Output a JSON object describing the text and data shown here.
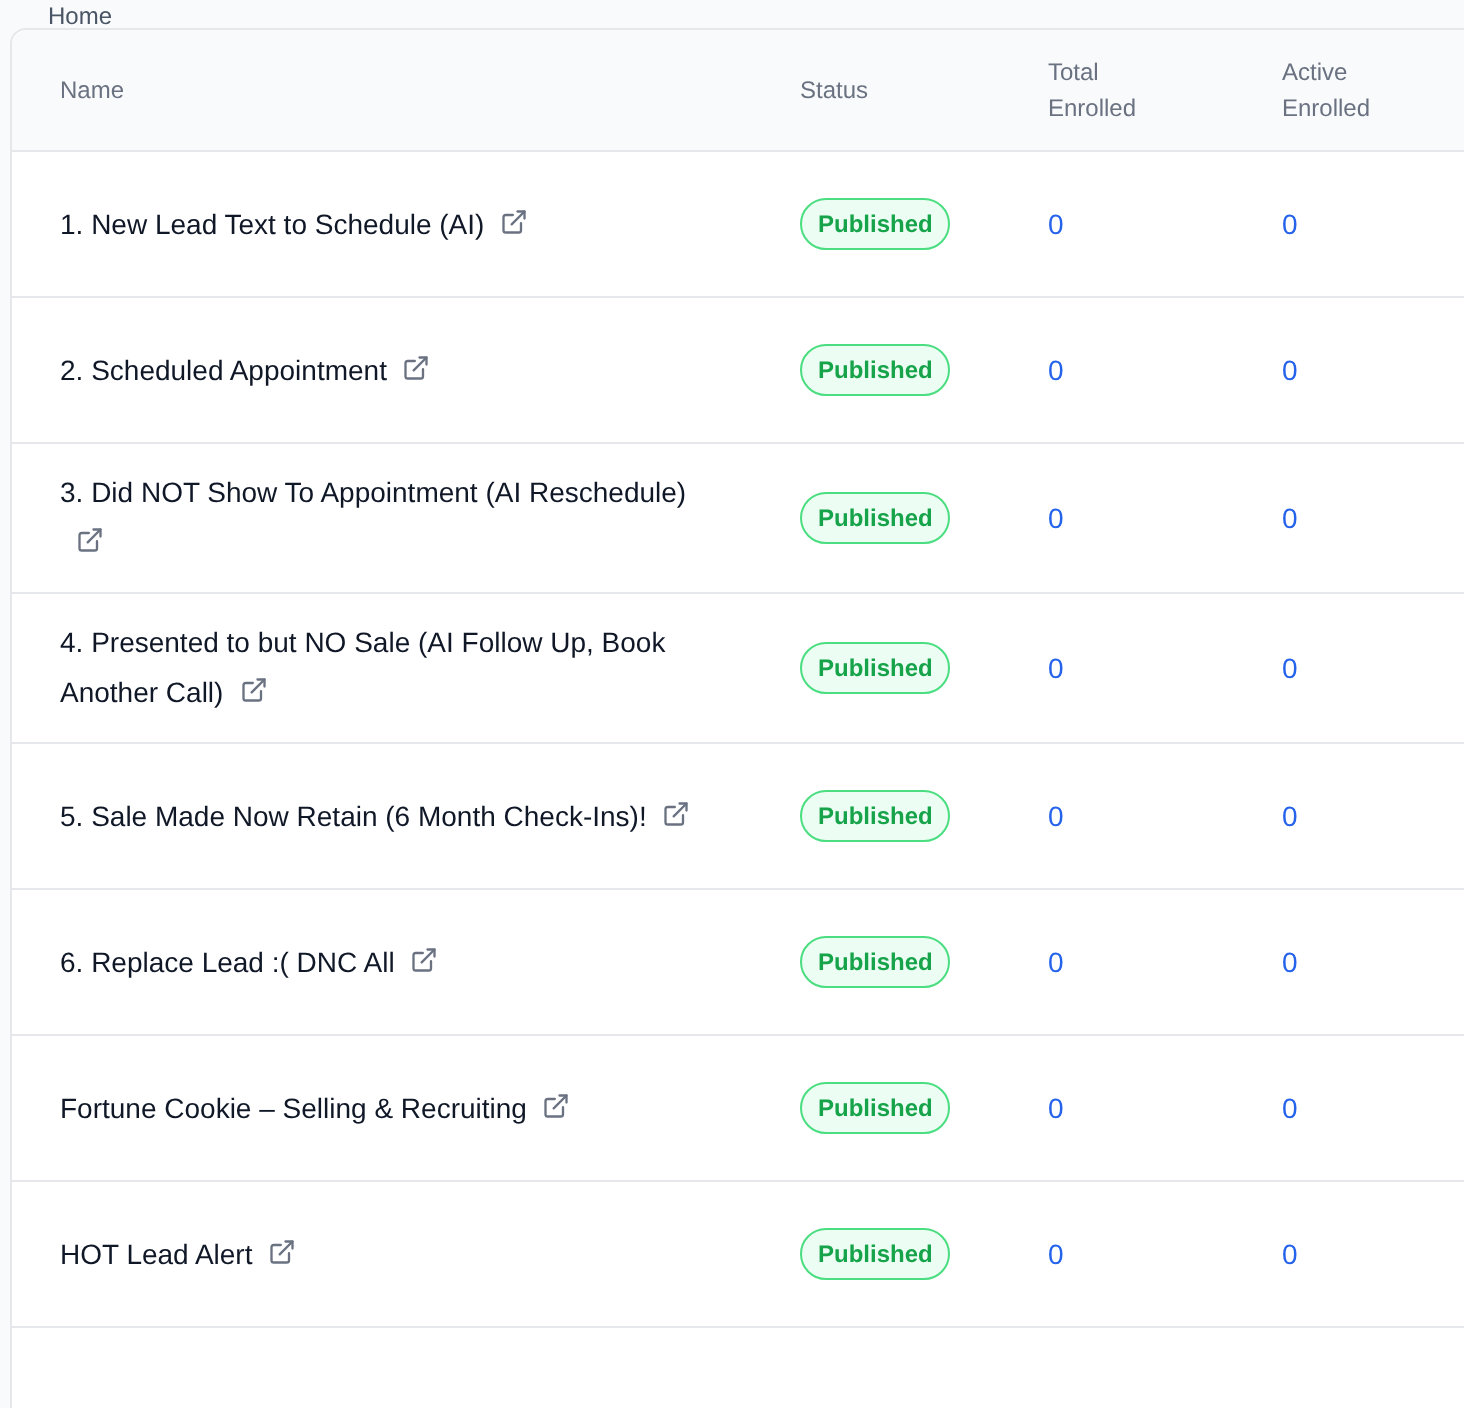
{
  "breadcrumb": "Home",
  "table": {
    "columns": [
      "Name",
      "Status",
      [
        "Total",
        "Enrolled"
      ],
      [
        "Active",
        "Enrolled"
      ]
    ],
    "rows": [
      {
        "name": "1. New Lead Text to Schedule (AI)",
        "status": "Published",
        "total_enrolled": "0",
        "active_enrolled": "0"
      },
      {
        "name": "2. Scheduled Appointment",
        "status": "Published",
        "total_enrolled": "0",
        "active_enrolled": "0"
      },
      {
        "name": "3. Did NOT Show To Appointment (AI Reschedule)",
        "status": "Published",
        "total_enrolled": "0",
        "active_enrolled": "0"
      },
      {
        "name": "4. Presented to but NO Sale (AI Follow Up, Book Another Call)",
        "status": "Published",
        "total_enrolled": "0",
        "active_enrolled": "0"
      },
      {
        "name": "5. Sale Made Now Retain (6 Month Check-Ins)!",
        "status": "Published",
        "total_enrolled": "0",
        "active_enrolled": "0"
      },
      {
        "name": "6. Replace Lead :( DNC All",
        "status": "Published",
        "total_enrolled": "0",
        "active_enrolled": "0"
      },
      {
        "name": "Fortune Cookie – Selling & Recruiting",
        "status": "Published",
        "total_enrolled": "0",
        "active_enrolled": "0"
      },
      {
        "name": "HOT Lead Alert",
        "status": "Published",
        "total_enrolled": "0",
        "active_enrolled": "0"
      }
    ]
  }
}
